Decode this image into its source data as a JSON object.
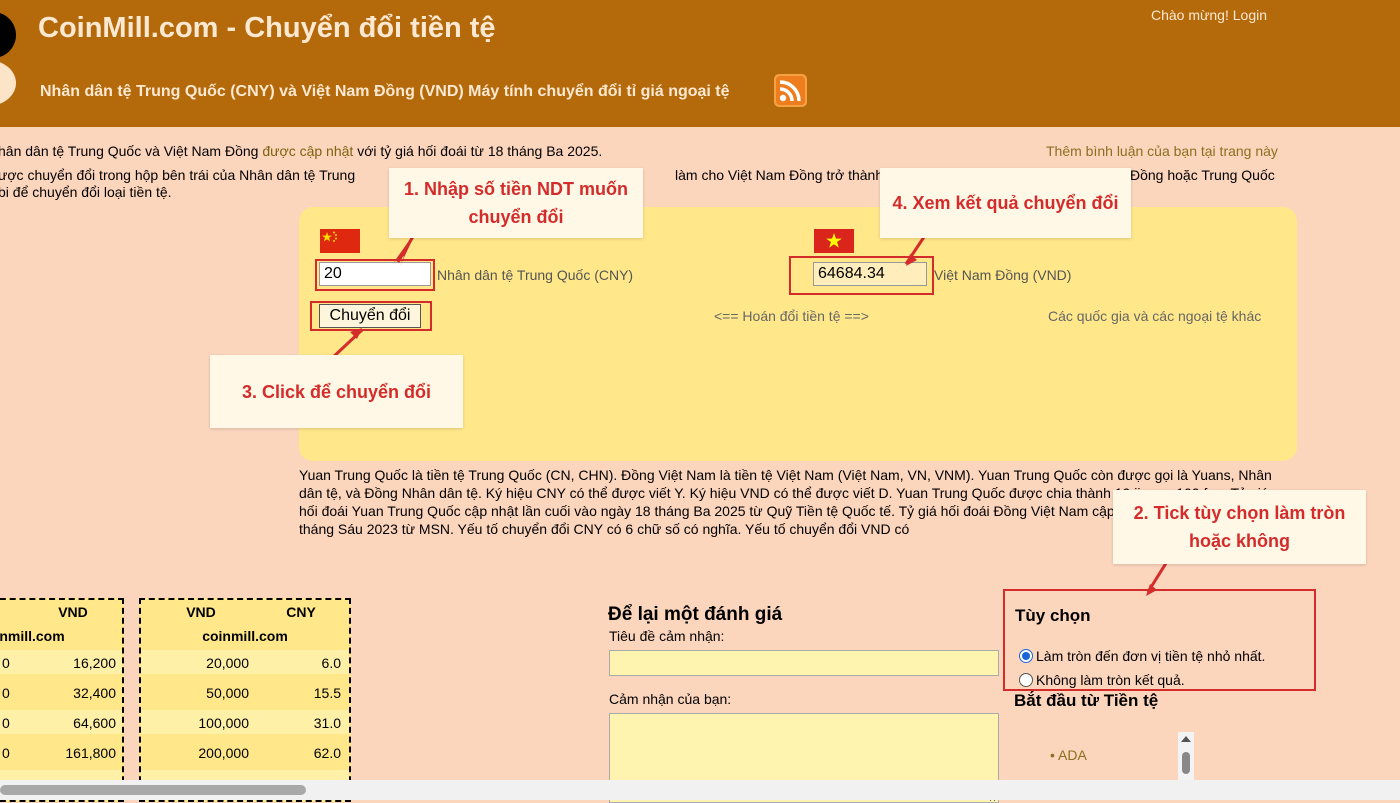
{
  "header": {
    "title": "CoinMill.com - Chuyển đổi tiền tệ",
    "subtitle": "Nhân dân tệ Trung Quốc (CNY) và Việt Nam Đồng (VND) Máy tính chuyển đổi tỉ giá ngoại tệ",
    "welcome_login": "Chào mừng! Login",
    "rss_icon": "rss-feed-icon"
  },
  "intro": {
    "line1_start": "hân dân tệ Trung Quốc và Việt Nam Đồng ",
    "line1_link": "được cập nhật",
    "line1_end": " với tỷ giá hối đoái từ 18 tháng Ba 2025.",
    "add_comment": "Thêm bình luận của bạn tại trang này",
    "line2a": "ược chuyển đổi trong hộp bên trái của Nhân dân tệ Trung",
    "line2b": "làm cho Việt Nam Đồng trở thành t",
    "line2c": "Đồng hoặc Trung Quốc",
    "line3": "bi để chuyển đổi loại tiền tệ."
  },
  "converter": {
    "cny_value": "20",
    "cny_label": "Nhân dân tệ Trung Quốc (CNY)",
    "vnd_value": "64684.34",
    "vnd_label": "Việt Nam Đồng (VND)",
    "convert_button": "Chuyển đổi",
    "swap_label": "<== Hoán đổi tiền tệ ==>",
    "other_currencies": "Các quốc gia và các ngoại tệ khác"
  },
  "description": "Yuan Trung Quốc là tiền tệ Trung Quốc (CN, CHN). Đồng Việt Nam là tiền tệ Việt Nam (Việt Nam, VN, VNM). Yuan Trung Quốc còn được gọi là Yuans, Nhân dân tệ, và Đồng Nhân dân tệ. Ký hiệu CNY có thể được viết Y. Ký hiệu VND có thể được viết D. Yuan Trung Quốc được chia thành 10 jiao or 100 fen. Tỷ giá hối đoái Yuan Trung Quốc cập nhật lần cuối vào ngày 18 tháng Ba 2025 từ Quỹ Tiền tệ Quốc tế. Tỷ giá hối đoái Đồng Việt Nam cập nhật lần cuối vào ngày 5 tháng Sáu 2023 từ MSN. Yếu tố chuyển đổi CNY có 6 chữ số có nghĩa. Yếu tố chuyển đổi VND có",
  "table_left": {
    "header_col2": "VND",
    "source": "nmill.com",
    "rows": [
      [
        "0",
        "16,200"
      ],
      [
        "0",
        "32,400"
      ],
      [
        "0",
        "64,600"
      ],
      [
        "0",
        "161,800"
      ]
    ]
  },
  "table_right": {
    "header_col1": "VND",
    "header_col2": "CNY",
    "source": "coinmill.com",
    "rows": [
      [
        "20,000",
        "6.0"
      ],
      [
        "50,000",
        "15.5"
      ],
      [
        "100,000",
        "31.0"
      ],
      [
        "200,000",
        "62.0"
      ]
    ]
  },
  "review": {
    "title": "Để lại một đánh giá",
    "title_label": "Tiêu đề cảm nhận:",
    "review_label": "Cảm nhận của bạn:"
  },
  "options": {
    "title": "Tùy chọn",
    "round_option": "Làm tròn đến đơn vị tiền tệ nhỏ nhất.",
    "no_round_option": "Không làm tròn kết quả.",
    "start_currency_title": "Bắt đầu từ Tiền tệ",
    "list_item": "ADA"
  },
  "annotations": {
    "step1_line1": "1. Nhập số tiền NDT muốn",
    "step1_line2": "chuyển đổi",
    "step2_line1": "2. Tick tùy chọn làm tròn",
    "step2_line2": "hoặc không",
    "step3": "3. Click để chuyển đổi",
    "step4": "4. Xem kết quả chuyển đổi",
    "color": "#d42b2b"
  },
  "colors": {
    "header_bg": "#b4690a",
    "page_bg": "#fcd5bd",
    "panel_bg": "#ffe78a"
  }
}
